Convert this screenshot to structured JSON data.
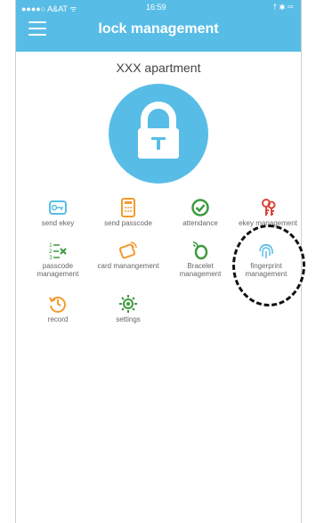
{
  "status_bar": {
    "carrier": "●●●●○ A&AT  ᯤ",
    "time": "16:59",
    "battery": "⭡ ✱ ▭"
  },
  "header": {
    "title": "lock management"
  },
  "apartment": {
    "name": "XXX apartment"
  },
  "colors": {
    "accent": "#58bde6",
    "orange": "#f39b2e",
    "green": "#3f9a3f",
    "red": "#d9453b"
  },
  "grid": [
    {
      "label": "send ekey",
      "icon": "key-icon"
    },
    {
      "label": "send passcode",
      "icon": "keypad-icon"
    },
    {
      "label": "attendance",
      "icon": "check-icon"
    },
    {
      "label": "ekey management",
      "icon": "keys-icon"
    },
    {
      "label": "passcode management",
      "icon": "list-icon"
    },
    {
      "label": "card manangement",
      "icon": "card-icon"
    },
    {
      "label": "Bracelet management",
      "icon": "bracelet-icon"
    },
    {
      "label": "fingerprint management",
      "icon": "fingerprint-icon"
    },
    {
      "label": "record",
      "icon": "history-icon"
    },
    {
      "label": "settings",
      "icon": "gear-icon"
    }
  ]
}
